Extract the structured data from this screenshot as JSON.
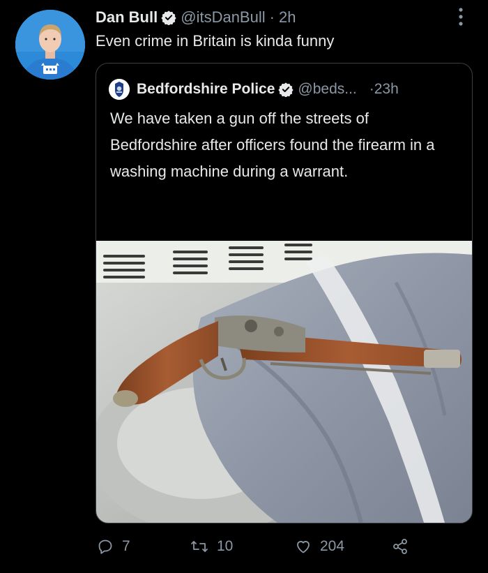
{
  "tweet": {
    "author_name": "Dan Bull",
    "author_handle": "@itsDanBull",
    "separator": "·",
    "time": "2h",
    "text": "Even crime in Britain is kinda funny",
    "avatar_icon": "avatar-person-blue-shirt",
    "verified_icon": "verified-badge-icon",
    "more_icon": "more-vertical-icon"
  },
  "quoted_tweet": {
    "author_name": "Bedfordshire Police",
    "author_handle": "@beds...",
    "separator": "·",
    "time": "23h",
    "text": "We have taken a gun off the streets of Bedfordshire after officers found the firearm in a washing machine during a warrant.",
    "ellipsis": "...",
    "avatar_icon": "police-crest-avatar",
    "media": "antique flintlock pistol on grey cloth in a washing machine"
  },
  "actions": {
    "replies": "7",
    "retweets": "10",
    "likes": "204",
    "reply_icon": "reply-icon",
    "retweet_icon": "retweet-icon",
    "like_icon": "heart-icon",
    "share_icon": "share-icon"
  },
  "colors": {
    "background": "#000000",
    "text_primary": "#e7e9ea",
    "text_secondary": "#8b98a5",
    "verified_blue": "#1d9bf0",
    "border": "#3a4046"
  }
}
